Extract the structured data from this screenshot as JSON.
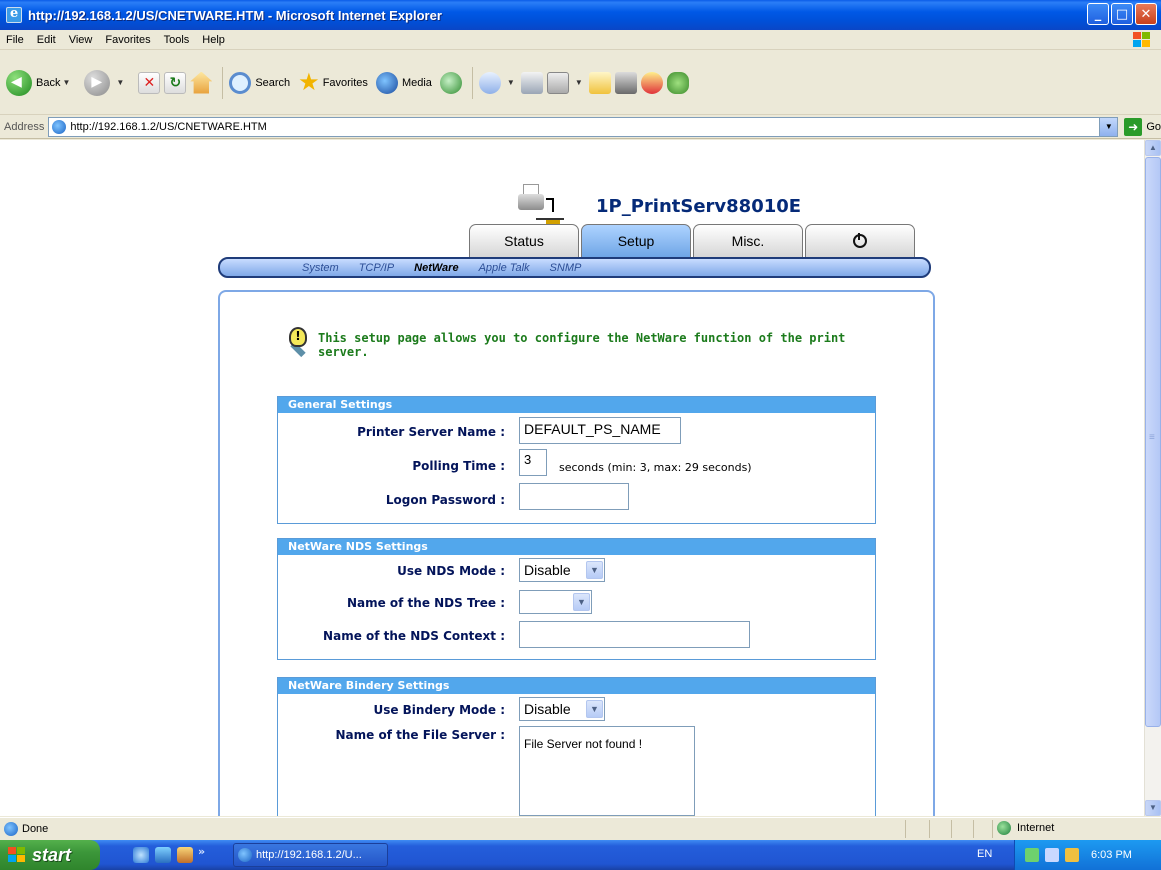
{
  "window": {
    "title": "http://192.168.1.2/US/CNETWARE.HTM - Microsoft Internet Explorer",
    "min": "_",
    "max": "□",
    "close": "✕"
  },
  "menu": [
    "File",
    "Edit",
    "View",
    "Favorites",
    "Tools",
    "Help"
  ],
  "toolbar": {
    "back": "Back",
    "search": "Search",
    "favorites": "Favorites",
    "media": "Media"
  },
  "address": {
    "label": "Address",
    "url": "http://192.168.1.2/US/CNETWARE.HTM",
    "go": "Go"
  },
  "page": {
    "server_name": "1P_PrintServ88010E",
    "tabs": [
      "Status",
      "Setup",
      "Misc."
    ],
    "active_tab": "Setup",
    "subnav": [
      "System",
      "TCP/IP",
      "NetWare",
      "Apple Talk",
      "SNMP"
    ],
    "active_subnav": "NetWare",
    "intro_line1": "This setup page allows you to configure the NetWare function of the print",
    "intro_line2": "server.",
    "general": {
      "header": "General Settings",
      "server_name_label": "Printer Server Name :",
      "server_name_value": "DEFAULT_PS_NAME",
      "polling_label": "Polling Time :",
      "polling_value": "3",
      "polling_hint": "seconds (min: 3, max: 29 seconds)",
      "password_label": "Logon Password :",
      "password_value": ""
    },
    "nds": {
      "header": "NetWare NDS Settings",
      "mode_label": "Use NDS Mode :",
      "mode_value": "Disable",
      "tree_label": "Name of the NDS Tree :",
      "tree_value": "",
      "context_label": "Name of the NDS Context :",
      "context_value": ""
    },
    "bindery": {
      "header": "NetWare Bindery Settings",
      "mode_label": "Use Bindery Mode :",
      "mode_value": "Disable",
      "file_server_label": "Name of the File Server :",
      "file_server_value": "File Server not found !"
    }
  },
  "status": {
    "text": "Done",
    "zone": "Internet"
  },
  "taskbar": {
    "start": "start",
    "task": "http://192.168.1.2/U...",
    "lang": "EN",
    "time": "6:03 PM"
  },
  "colors": {
    "accent_blue": "#0058e6",
    "section_header": "#52a7ec",
    "label_navy": "#03145a",
    "intro_green": "#1c7b1c"
  }
}
